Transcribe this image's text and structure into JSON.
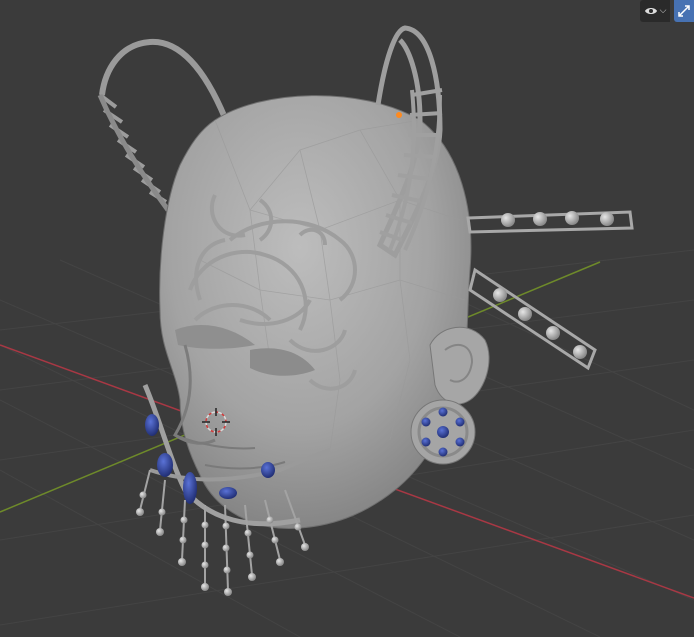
{
  "app": "3D Viewport",
  "overlay_controls": {
    "visibility_icon": "eye-icon",
    "dropdown_icon": "chevron-down-icon",
    "gizmo_icon": "transform-gizmo-icon",
    "gizmo_active": true
  },
  "colors": {
    "background": "#3b3b3b",
    "grid": "#444444",
    "x_axis": "#a83844",
    "y_axis": "#6e8a2a",
    "mesh": "#a9a9a9",
    "mesh_shadow": "#8e8e8e",
    "gem": "#2c3f9b",
    "origin_dot": "#ff8a1e",
    "accent": "#4772b3"
  }
}
